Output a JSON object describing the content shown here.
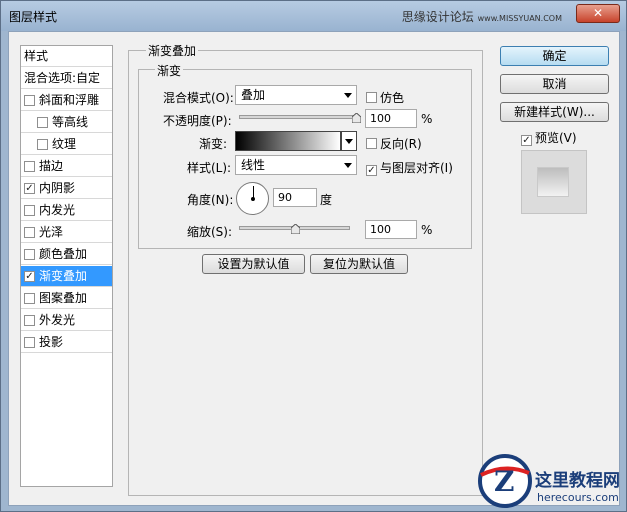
{
  "window": {
    "title": "图层样式",
    "watermark": "思缘设计论坛",
    "watermark_url": "www.MISSYUAN.COM",
    "close_glyph": "✕"
  },
  "sidebar": {
    "header": "样式",
    "blend_options": "混合选项:自定",
    "items": [
      {
        "label": "斜面和浮雕",
        "checked": false,
        "sub": false,
        "selected": false
      },
      {
        "label": "等高线",
        "checked": false,
        "sub": true,
        "selected": false
      },
      {
        "label": "纹理",
        "checked": false,
        "sub": true,
        "selected": false
      },
      {
        "label": "描边",
        "checked": false,
        "sub": false,
        "selected": false
      },
      {
        "label": "内阴影",
        "checked": true,
        "sub": false,
        "selected": false
      },
      {
        "label": "内发光",
        "checked": false,
        "sub": false,
        "selected": false
      },
      {
        "label": "光泽",
        "checked": false,
        "sub": false,
        "selected": false
      },
      {
        "label": "颜色叠加",
        "checked": false,
        "sub": false,
        "selected": false
      },
      {
        "label": "渐变叠加",
        "checked": true,
        "sub": false,
        "selected": true
      },
      {
        "label": "图案叠加",
        "checked": false,
        "sub": false,
        "selected": false
      },
      {
        "label": "外发光",
        "checked": false,
        "sub": false,
        "selected": false
      },
      {
        "label": "投影",
        "checked": false,
        "sub": false,
        "selected": false
      }
    ]
  },
  "panel": {
    "group_title": "渐变叠加",
    "subgroup_title": "渐变",
    "blend_mode_label": "混合模式(O):",
    "blend_mode_value": "叠加",
    "dither_label": "仿色",
    "dither_checked": false,
    "opacity_label": "不透明度(P):",
    "opacity_value": "100",
    "opacity_unit": "%",
    "opacity_level": 1.0,
    "gradient_label": "渐变:",
    "reverse_label": "反向(R)",
    "reverse_checked": false,
    "style_label": "样式(L):",
    "style_value": "线性",
    "align_label": "与图层对齐(I)",
    "align_checked": true,
    "angle_label": "角度(N):",
    "angle_value": "90",
    "angle_unit": "度",
    "scale_label": "缩放(S):",
    "scale_value": "100",
    "scale_unit": "%",
    "scale_level": 0.5,
    "make_default_label": "设置为默认值",
    "reset_default_label": "复位为默认值"
  },
  "buttons": {
    "ok": "确定",
    "cancel": "取消",
    "new_style": "新建样式(W)...",
    "preview_label": "预览(V)",
    "preview_checked": true
  },
  "logo": {
    "text_cn": "这里教程网",
    "text_en": "herecours.com",
    "letter": "Z"
  },
  "colors": {
    "selection": "#3399ff",
    "titlebar": "#99b3d0",
    "default_button": "#b6dcf1",
    "close_button": "#c7432b"
  }
}
